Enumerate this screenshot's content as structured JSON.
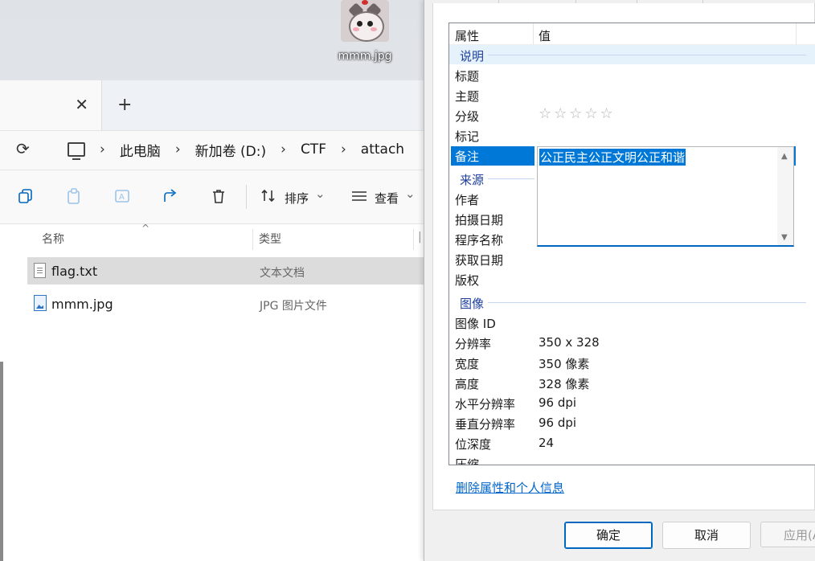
{
  "desktop": {
    "icon_label": "mmm.jpg"
  },
  "explorer": {
    "tab_close": "✕",
    "new_tab": "+",
    "refresh": "⟳",
    "breadcrumb": [
      "此电脑",
      "新加卷 (D:)",
      "CTF",
      "attach"
    ],
    "breadcrumb_sep": "›",
    "toolbar": {
      "sort_label": "排序",
      "view_label": "查看",
      "chevron": "⌄"
    },
    "columns": {
      "name": "名称",
      "type": "类型",
      "third": "|"
    },
    "files": [
      {
        "name": "flag.txt",
        "type": "文本文档",
        "selected": true,
        "icon": "text-file-icon"
      },
      {
        "name": "mmm.jpg",
        "type": "JPG 图片文件",
        "selected": false,
        "icon": "image-file-icon"
      }
    ]
  },
  "properties": {
    "header": {
      "property": "属性",
      "value": "值"
    },
    "groups": {
      "description": "说明",
      "origin": "来源",
      "image": "图像"
    },
    "desc_rows": {
      "title": "标题",
      "subject": "主题",
      "rating": "分级",
      "tags": "标记",
      "comments": "备注"
    },
    "rating_stars": "☆☆☆☆☆",
    "comment_value": "公正民主公正文明公正和谐",
    "origin_rows": {
      "author": "作者",
      "date_taken": "拍摄日期",
      "program": "程序名称",
      "date_acquired": "获取日期",
      "copyright": "版权"
    },
    "image_rows": [
      {
        "label": "图像 ID",
        "value": ""
      },
      {
        "label": "分辨率",
        "value": "350 x 328"
      },
      {
        "label": "宽度",
        "value": "350 像素"
      },
      {
        "label": "高度",
        "value": "328 像素"
      },
      {
        "label": "水平分辨率",
        "value": "96 dpi"
      },
      {
        "label": "垂直分辨率",
        "value": "96 dpi"
      },
      {
        "label": "位深度",
        "value": "24"
      },
      {
        "label": "压缩",
        "value": ""
      }
    ],
    "remove_link": "删除属性和个人信息",
    "buttons": {
      "ok": "确定",
      "cancel": "取消",
      "apply": "应用(A)"
    }
  }
}
